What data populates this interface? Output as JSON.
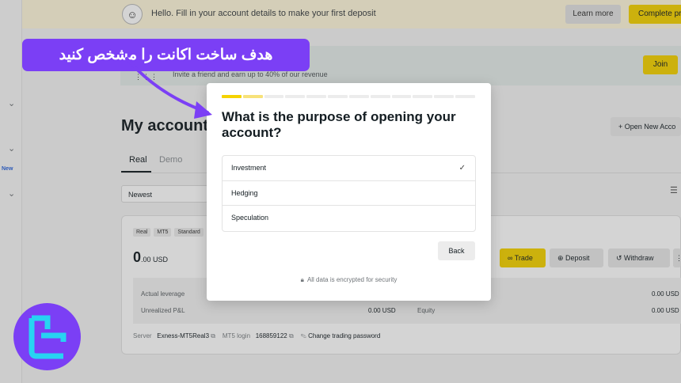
{
  "topbar": {
    "hello_text": "Hello. Fill in your account details to make your first deposit",
    "learn_more": "Learn more",
    "complete_profile": "Complete pro"
  },
  "sidebar": {
    "new_badge": "New"
  },
  "invite": {
    "text": "Invite a friend and earn up to 40% of our revenue",
    "join": "Join"
  },
  "page": {
    "title": "My account",
    "open_new_account": "Open New Acco",
    "tabs": [
      "Real",
      "Demo"
    ],
    "active_tab": "Real",
    "sort_value": "Newest"
  },
  "account_card": {
    "badges": [
      "Real",
      "MT5",
      "Standard"
    ],
    "balance_major": "0",
    "balance_minor": ".00 USD",
    "actions": {
      "trade": "Trade",
      "deposit": "Deposit",
      "withdraw": "Withdraw"
    },
    "stats": {
      "actual_leverage_label": "Actual leverage",
      "unrealized_pnl_label": "Unrealized P&L",
      "unrealized_pnl_value": "0.00 USD",
      "equity_label": "Equity",
      "right_value_1": "0.00 USD",
      "right_value_2": "0.00 USD"
    },
    "server_label": "Server",
    "server_value": "Exness-MT5Real3",
    "mt5_login_label": "MT5 login",
    "mt5_login_value": "168859122",
    "change_password": "Change trading password"
  },
  "modal": {
    "progress_total_steps": 12,
    "progress_completed_steps": 1,
    "question": "What is the purpose of opening your account?",
    "options": [
      {
        "label": "Investment",
        "selected": true
      },
      {
        "label": "Hedging",
        "selected": false
      },
      {
        "label": "Speculation",
        "selected": false
      }
    ],
    "back": "Back",
    "security_note": "All data is encrypted for security"
  },
  "annotation": {
    "callout_text": "هدف ساخت اکانت را مشخص کنید"
  },
  "colors": {
    "brand_yellow": "#f5d300",
    "callout_purple": "#7b3ff5",
    "logo_cyan": "#27d3f2"
  }
}
